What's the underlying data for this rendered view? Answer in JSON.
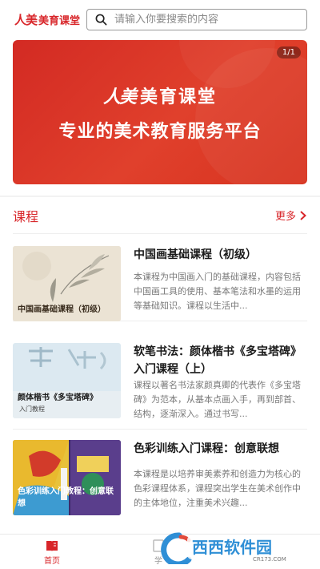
{
  "header": {
    "logo_mark": "人美",
    "logo_text": "美育课堂",
    "search_placeholder": "请输入你要搜索的内容"
  },
  "banner": {
    "pager": "1/1",
    "brand_mark": "人美",
    "brand_text": "美育课堂",
    "slogan": "专业的美术教育服务平台"
  },
  "courses_section": {
    "title": "课程",
    "more_label": "更多"
  },
  "courses": [
    {
      "title": "中国画基础课程（初级）",
      "thumb_label": "中国画基础课程（初级）",
      "description": "本课程为中国画入门的基础课程，内容包括中国画工具的使用、基本笔法和水墨的运用等基础知识。课程以生活中..."
    },
    {
      "title": "软笔书法：颜体楷书《多宝塔碑》入门课程（上）",
      "thumb_label": "颜体楷书《多宝塔碑》",
      "thumb_sub": "入门教程",
      "description": "课程以著名书法家颜真卿的代表作《多宝塔碑》为范本，从基本点画入手，再到部首、结构，逐渐深入。通过书写..."
    },
    {
      "title": "色彩训练入门课程：创意联想",
      "thumb_label": "色彩训练入门教程：创意联想",
      "description": "本课程是以培养审美素养和创造力为核心的色彩课程体系，课程突出学生在美术创作中的主体地位，注重美术兴趣..."
    }
  ],
  "tabbar": {
    "home_label": "首页",
    "study_label": "学"
  },
  "watermark": {
    "text": "西西软件园",
    "sub": "CR173.COM"
  },
  "colors": {
    "accent": "#d8262a"
  }
}
